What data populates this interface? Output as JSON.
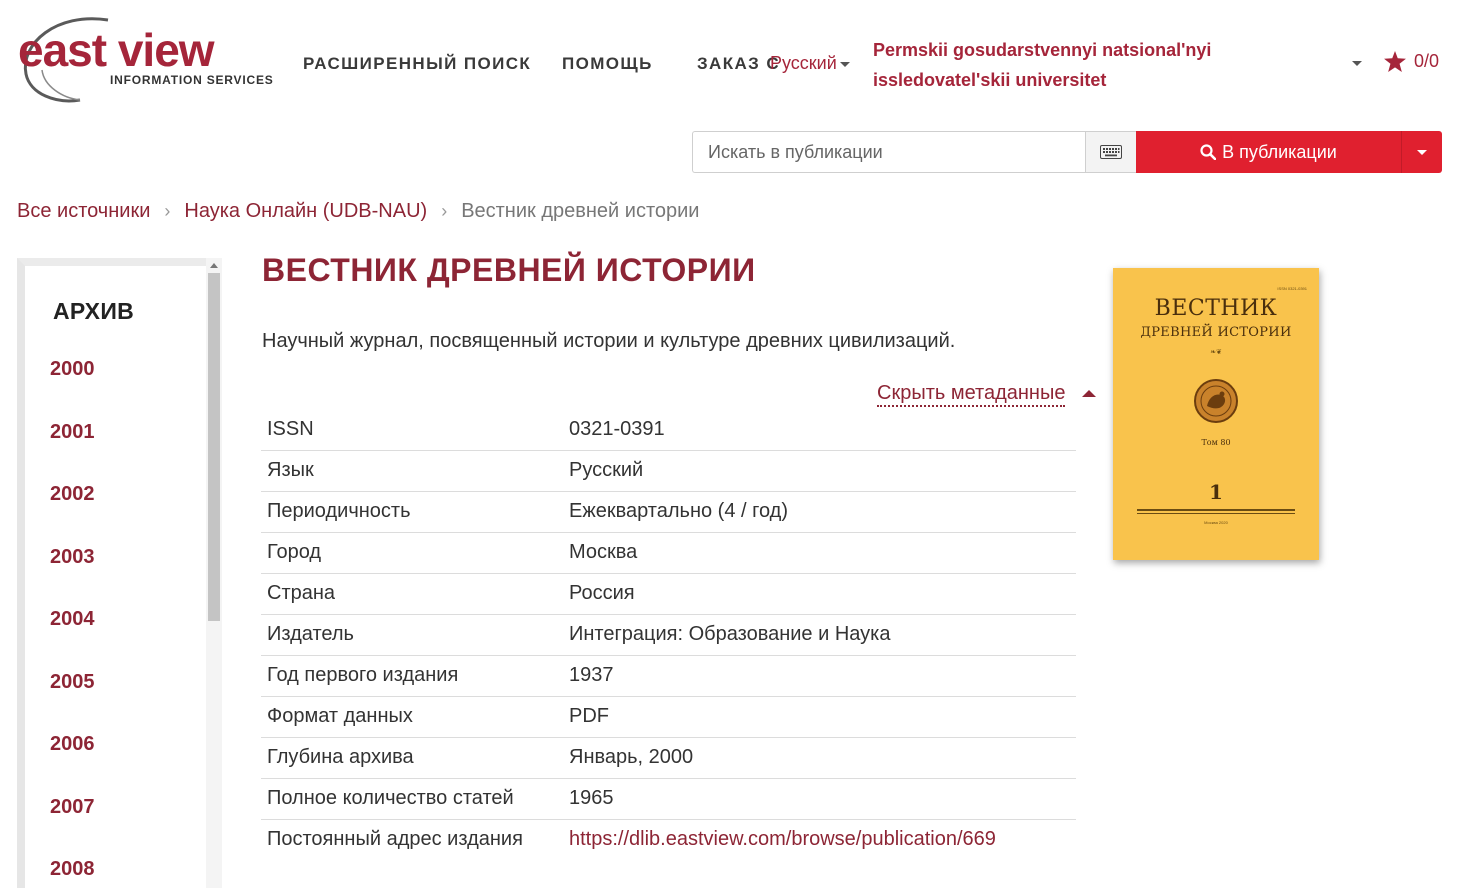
{
  "header": {
    "logo": {
      "word": "east view",
      "tagline": "INFORMATION SERVICES"
    },
    "nav": {
      "advanced_search": "РАСШИРЕННЫЙ ПОИСК",
      "help": "ПОМОЩЬ",
      "order": "ЗАКАЗ С"
    },
    "language": "Русский",
    "organization": "Permskii gosudarstvennyi natsional'nyi issledovatel'skii universitet",
    "favorites": {
      "icon": "star-icon",
      "count": "0/0"
    }
  },
  "search": {
    "placeholder": "Искать в публикации",
    "keyboard_icon": "keyboard-icon",
    "button_label": "В публикации",
    "button_icon": "search-icon"
  },
  "breadcrumb": [
    {
      "label": "Все источники"
    },
    {
      "label": "Наука Онлайн (UDB-NAU)"
    },
    {
      "label": "Вестник древней истории"
    }
  ],
  "sidebar": {
    "title": "АРХИВ",
    "years": [
      "2000",
      "2001",
      "2002",
      "2003",
      "2004",
      "2005",
      "2006",
      "2007",
      "2008"
    ]
  },
  "publication": {
    "title": "ВЕСТНИК ДРЕВНЕЙ ИСТОРИИ",
    "description": "Научный журнал, посвященный истории и культуре древних цивилизаций.",
    "metadata_toggle": "Скрыть метаданные",
    "metadata": [
      {
        "key": "ISSN",
        "value": "0321-0391"
      },
      {
        "key": "Язык",
        "value": "Русский"
      },
      {
        "key": "Периодичность",
        "value": "Ежеквартально (4 / год)"
      },
      {
        "key": "Город",
        "value": "Москва"
      },
      {
        "key": "Страна",
        "value": "Россия"
      },
      {
        "key": "Издатель",
        "value": "Интеграция: Образование и Наука"
      },
      {
        "key": "Год первого издания",
        "value": "1937"
      },
      {
        "key": "Формат данных",
        "value": "PDF"
      },
      {
        "key": "Глубина архива",
        "value": "Январь, 2000"
      },
      {
        "key": "Полное количество статей",
        "value": "1965"
      },
      {
        "key": "Постоянный адрес издания",
        "value": "https://dlib.eastview.com/browse/publication/669"
      }
    ],
    "cover": {
      "issn": "ISSN 0321-0391",
      "title_line1": "ВЕСТНИК",
      "title_line2": "ДРЕВНЕЙ ИСТОРИИ",
      "volume": "Том 80",
      "issue": "1",
      "city_year": "Москва 2020"
    }
  },
  "colors": {
    "brand": "#8d2535",
    "accent_red": "#e0202f",
    "cover_bg": "#f9c34c"
  }
}
